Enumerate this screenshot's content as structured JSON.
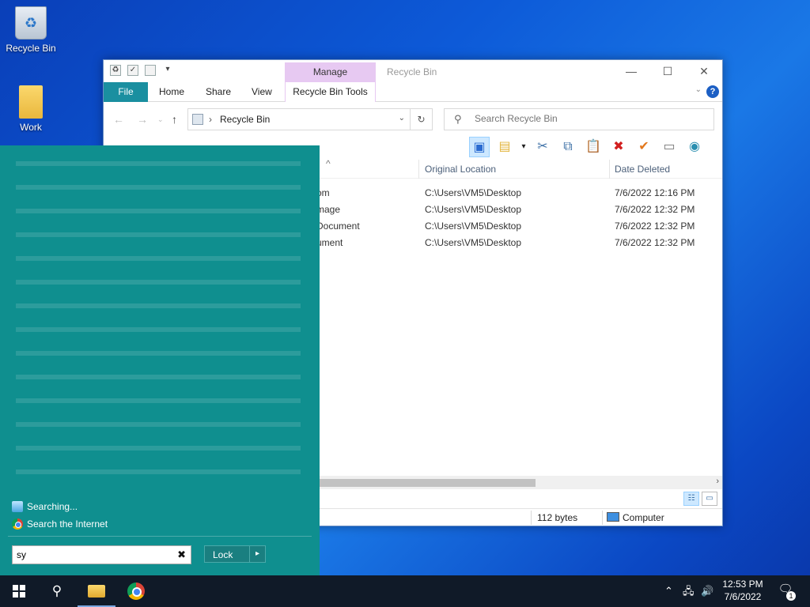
{
  "desktop": {
    "icons": [
      {
        "label": "Recycle Bin"
      },
      {
        "label": "Work"
      }
    ]
  },
  "window": {
    "title": "Recycle Bin",
    "manage_tab": "Manage",
    "tabs": {
      "file": "File",
      "home": "Home",
      "share": "Share",
      "view": "View",
      "tools": "Recycle Bin Tools"
    },
    "address": {
      "path": "Recycle Bin"
    },
    "search": {
      "placeholder": "Search Recycle Bin"
    },
    "columns": {
      "sort_arrow": "^",
      "original_location": "Original Location",
      "date_deleted": "Date Deleted"
    },
    "rows": [
      {
        "name": "om",
        "location": "C:\\Users\\VM5\\Desktop",
        "date": "7/6/2022 12:16 PM"
      },
      {
        "name": "mage",
        "location": "C:\\Users\\VM5\\Desktop",
        "date": "7/6/2022 12:32 PM"
      },
      {
        "name": " Document",
        "location": "C:\\Users\\VM5\\Desktop",
        "date": "7/6/2022 12:32 PM"
      },
      {
        "name": "ument",
        "location": "C:\\Users\\VM5\\Desktop",
        "date": "7/6/2022 12:32 PM"
      }
    ],
    "status": {
      "size": "112 bytes",
      "zone": "Computer"
    }
  },
  "start_menu": {
    "searching_label": "Searching...",
    "search_internet_label": "Search the Internet",
    "search_value": "sy",
    "lock_label": "Lock",
    "bg_color": "#0f8f8f"
  },
  "taskbar": {
    "time": "12:53 PM",
    "date": "7/6/2022",
    "notification_count": "1"
  }
}
